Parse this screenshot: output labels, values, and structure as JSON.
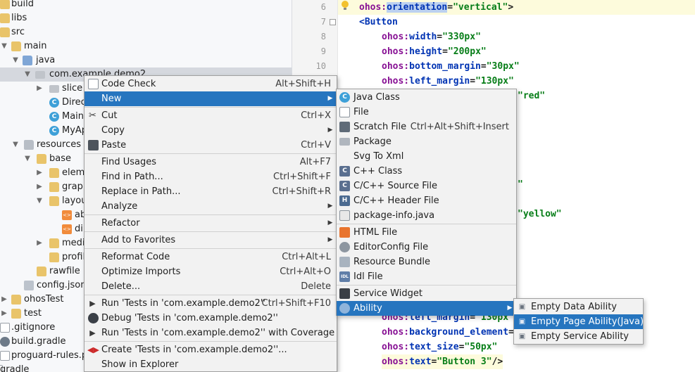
{
  "tree": {
    "items": [
      {
        "label": "build",
        "icon": "folder-icon"
      },
      {
        "label": "libs",
        "icon": "folder-icon"
      },
      {
        "label": "src",
        "icon": "folder-icon"
      },
      {
        "label": "main",
        "icon": "folder-icon"
      },
      {
        "label": "java",
        "icon": "folder-icon"
      },
      {
        "label": "com.example.demo2",
        "icon": "package-icon"
      },
      {
        "label": "slice",
        "icon": "package-icon"
      },
      {
        "label": "Direc",
        "icon": "class-icon"
      },
      {
        "label": "MainA",
        "icon": "class-icon"
      },
      {
        "label": "MyAp",
        "icon": "class-icon"
      },
      {
        "label": "resources",
        "icon": "folder-icon"
      },
      {
        "label": "base",
        "icon": "folder-icon"
      },
      {
        "label": "eleme",
        "icon": "folder-icon"
      },
      {
        "label": "graph",
        "icon": "folder-icon"
      },
      {
        "label": "layou",
        "icon": "folder-icon"
      },
      {
        "label": "ab",
        "icon": "xml-icon"
      },
      {
        "label": "dir",
        "icon": "xml-icon"
      },
      {
        "label": "media",
        "icon": "folder-icon"
      },
      {
        "label": "profil",
        "icon": "folder-icon"
      },
      {
        "label": "rawfile",
        "icon": "folder-icon"
      },
      {
        "label": "config.json",
        "icon": "json-icon"
      },
      {
        "label": "ohosTest",
        "icon": "folder-icon"
      },
      {
        "label": "test",
        "icon": "folder-icon"
      },
      {
        "label": ".gitignore",
        "icon": "file-icon"
      },
      {
        "label": "build.gradle",
        "icon": "gradle-icon"
      },
      {
        "label": "proguard-rules.pr",
        "icon": "file-icon"
      },
      {
        "label": "gradle",
        "icon": "file-icon"
      }
    ]
  },
  "editor": {
    "line_numbers": [
      "6",
      "7",
      "8",
      "9",
      "10"
    ],
    "lines": [
      {
        "ns": "ohos:",
        "attr": "orientation",
        "eq": "=",
        "val": "\"vertical\"",
        "end": ">"
      },
      {
        "tag": "<Button"
      },
      {
        "ns": "ohos:",
        "attr": "width",
        "eq": "=",
        "val": "\"330px\""
      },
      {
        "ns": "ohos:",
        "attr": "height",
        "eq": "=",
        "val": "\"200px\""
      },
      {
        "ns": "ohos:",
        "attr": "bottom_margin",
        "eq": "=",
        "val": "\"30px\""
      },
      {
        "ns": "ohos:",
        "attr": "left_margin",
        "eq": "=",
        "val": "\"130px\""
      }
    ],
    "frag_red": "\"red\"",
    "frag_quote": "\"",
    "frag_yellow": "\"yellow\"",
    "bottom_lines": [
      {
        "ns": "ohos:",
        "attr": "left_margin",
        "eq": "=",
        "val": "\"130px"
      },
      {
        "ns": "ohos:",
        "attr": "background_element",
        "eq": "=",
        "val": ""
      },
      {
        "ns": "ohos:",
        "attr": "text_size",
        "eq": "=",
        "val": "\"50px\""
      },
      {
        "ns": "ohos:",
        "attr": "text",
        "eq": "=",
        "val": "\"Button 3\"",
        "end": "/>"
      }
    ]
  },
  "context_menu": {
    "items": [
      {
        "label": "Code Check",
        "shortcut": "Alt+Shift+H"
      },
      {
        "label": "New",
        "shortcut": ""
      },
      {
        "label": "Cut",
        "shortcut": "Ctrl+X"
      },
      {
        "label": "Copy",
        "shortcut": ""
      },
      {
        "label": "Paste",
        "shortcut": "Ctrl+V"
      },
      {
        "label": "Find Usages",
        "shortcut": "Alt+F7"
      },
      {
        "label": "Find in Path...",
        "shortcut": "Ctrl+Shift+F"
      },
      {
        "label": "Replace in Path...",
        "shortcut": "Ctrl+Shift+R"
      },
      {
        "label": "Analyze",
        "shortcut": ""
      },
      {
        "label": "Refactor",
        "shortcut": ""
      },
      {
        "label": "Add to Favorites",
        "shortcut": ""
      },
      {
        "label": "Reformat Code",
        "shortcut": "Ctrl+Alt+L"
      },
      {
        "label": "Optimize Imports",
        "shortcut": "Ctrl+Alt+O"
      },
      {
        "label": "Delete...",
        "shortcut": "Delete"
      },
      {
        "label": "Run 'Tests in 'com.example.demo2''",
        "shortcut": "Ctrl+Shift+F10"
      },
      {
        "label": "Debug 'Tests in 'com.example.demo2''",
        "shortcut": ""
      },
      {
        "label": "Run 'Tests in 'com.example.demo2'' with Coverage",
        "shortcut": ""
      },
      {
        "label": "Create 'Tests in 'com.example.demo2''...",
        "shortcut": ""
      },
      {
        "label": "Show in Explorer",
        "shortcut": ""
      }
    ]
  },
  "new_menu": {
    "items": [
      {
        "label": "Java Class",
        "shortcut": ""
      },
      {
        "label": "File",
        "shortcut": ""
      },
      {
        "label": "Scratch File",
        "shortcut": "Ctrl+Alt+Shift+Insert"
      },
      {
        "label": "Package",
        "shortcut": ""
      },
      {
        "label": "Svg To Xml",
        "shortcut": ""
      },
      {
        "label": "C++ Class",
        "shortcut": ""
      },
      {
        "label": "C/C++ Source File",
        "shortcut": ""
      },
      {
        "label": "C/C++ Header File",
        "shortcut": ""
      },
      {
        "label": "package-info.java",
        "shortcut": ""
      },
      {
        "label": "HTML File",
        "shortcut": ""
      },
      {
        "label": "EditorConfig File",
        "shortcut": ""
      },
      {
        "label": "Resource Bundle",
        "shortcut": ""
      },
      {
        "label": "Idl File",
        "shortcut": ""
      },
      {
        "label": "Service Widget",
        "shortcut": ""
      },
      {
        "label": "Ability",
        "shortcut": ""
      }
    ]
  },
  "ability_menu": {
    "items": [
      {
        "label": "Empty Data Ability"
      },
      {
        "label": "Empty Page Ability(Java)"
      },
      {
        "label": "Empty Service Ability"
      }
    ]
  },
  "colors": {
    "selection": "#2675bf",
    "menu_bg": "#f2f2f2",
    "tree_selected": "#d5d8de"
  }
}
